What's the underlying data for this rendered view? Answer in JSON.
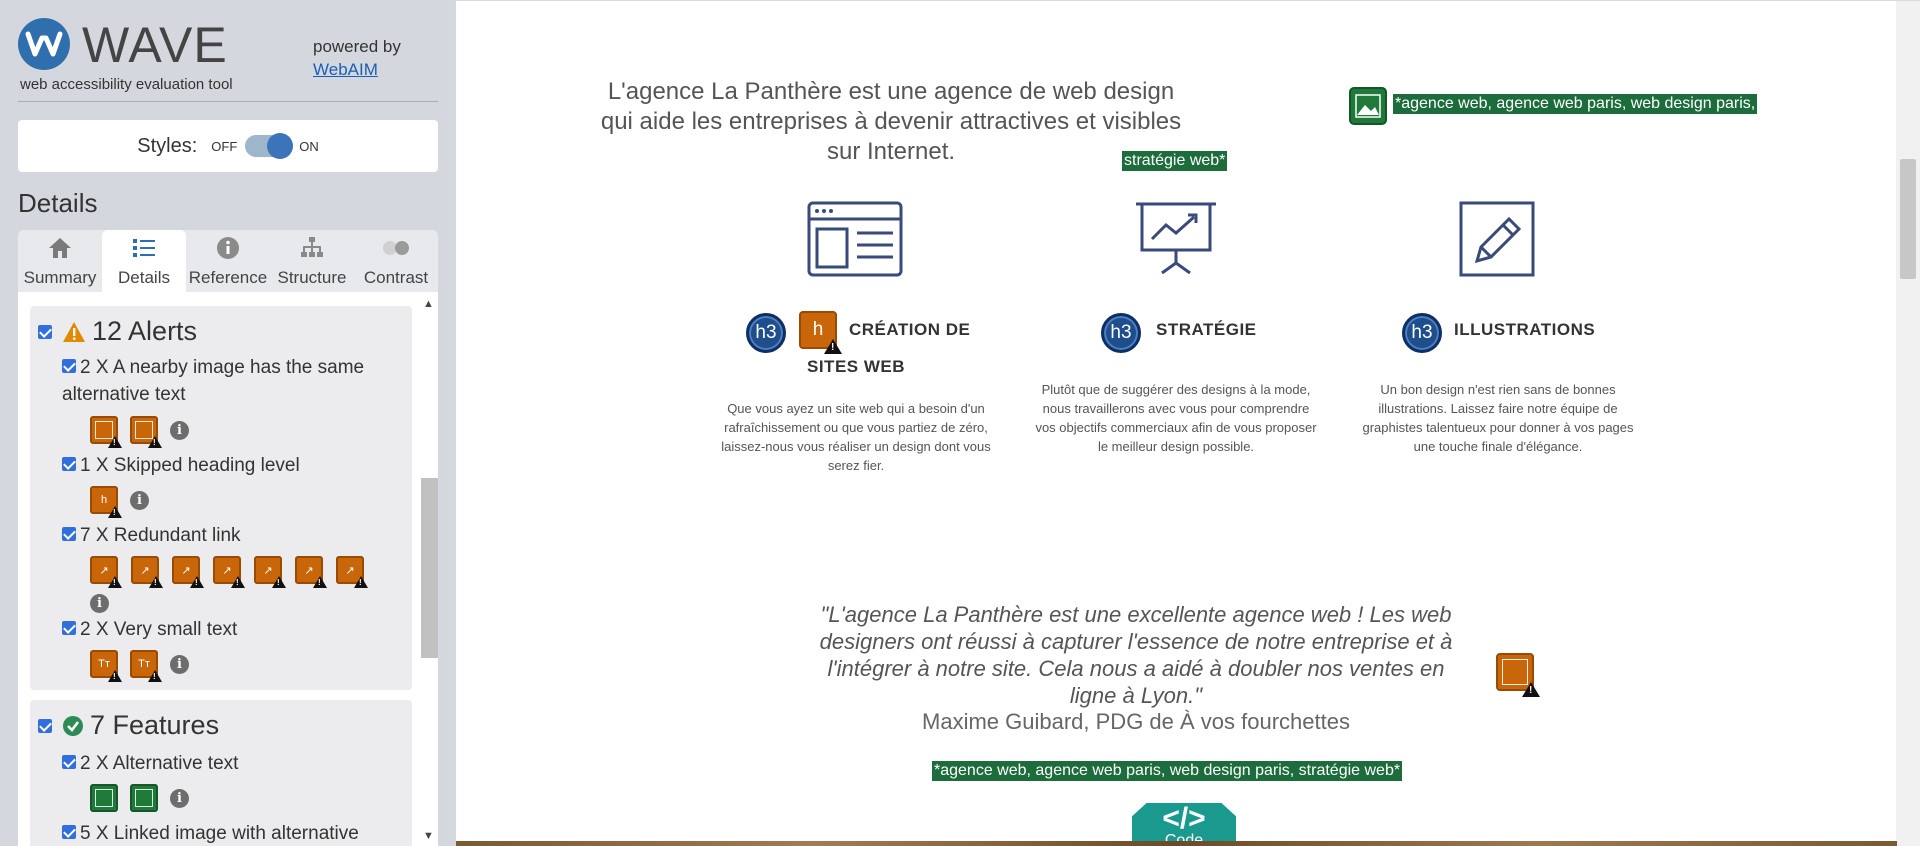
{
  "wave": {
    "title": "WAVE",
    "subtitle": "web accessibility evaluation tool",
    "powered_by": "powered by",
    "webaim_link": "WebAIM",
    "styles_label": "Styles:",
    "styles_off": "OFF",
    "styles_on": "ON",
    "styles_state": "on",
    "details_heading": "Details",
    "tabs": [
      {
        "label": "Summary",
        "icon": "home-icon"
      },
      {
        "label": "Details",
        "icon": "list-icon",
        "active": true
      },
      {
        "label": "Reference",
        "icon": "info-icon"
      },
      {
        "label": "Structure",
        "icon": "structure-icon"
      },
      {
        "label": "Contrast",
        "icon": "contrast-icon"
      }
    ],
    "alerts": {
      "heading": "12 Alerts",
      "items": [
        {
          "label": "2 X A nearby image has the same alternative text"
        },
        {
          "label": "1 X Skipped heading level"
        },
        {
          "label": "7 X Redundant link"
        },
        {
          "label": "2 X Very small text"
        }
      ]
    },
    "features": {
      "heading": "7 Features",
      "items": [
        {
          "label": "2 X Alternative text"
        },
        {
          "label": "5 X Linked image with alternative"
        }
      ]
    }
  },
  "page": {
    "intro": "L'agence La Panthère est une agence de web design qui aide les entreprises à devenir attractives et visibles sur Internet.",
    "keyword_line1": "*agence web, agence web paris, web design paris,",
    "keyword_line2": "stratégie web*",
    "h3_badge": "h3",
    "services": [
      {
        "title_line1": "CRÉATION DE",
        "title_line2": "SITES WEB",
        "text": "Que vous ayez un site web qui a besoin d'un rafraîchissement ou que vous partiez de zéro, laissez-nous vous réaliser un design dont vous serez fier."
      },
      {
        "title": "STRATÉGIE",
        "text": "Plutôt que de suggérer des designs à la mode, nous travaillerons avec vous pour comprendre vos objectifs commerciaux afin de vous proposer le meilleur design possible."
      },
      {
        "title": "ILLUSTRATIONS",
        "text": "Un bon design n'est rien sans de bonnes illustrations. Laissez faire notre équipe de graphistes talentueux pour donner à vos pages une touche finale d'élégance."
      }
    ],
    "quote": "\"L'agence La Panthère est une excellente agence web ! Les web designers ont réussi à capturer l'essence de notre entreprise et à l'intégrer à notre site. Cela nous a aidé à doubler nos ventes en ligne à Lyon.\"",
    "author": "Maxime Guibard, PDG de À vos fourchettes",
    "keyword_bottom": "*agence web, agence web paris, web design paris, stratégie web*",
    "code_button": "Code",
    "code_symbol": "</>"
  },
  "colors": {
    "wave_blue": "#2f6fae",
    "alert_orange": "#c9660a",
    "feature_green": "#1f7a3a",
    "heading_badge": "#1e4e8c",
    "keyword_green": "#1c6c3c",
    "code_teal": "#1a9a8e"
  }
}
